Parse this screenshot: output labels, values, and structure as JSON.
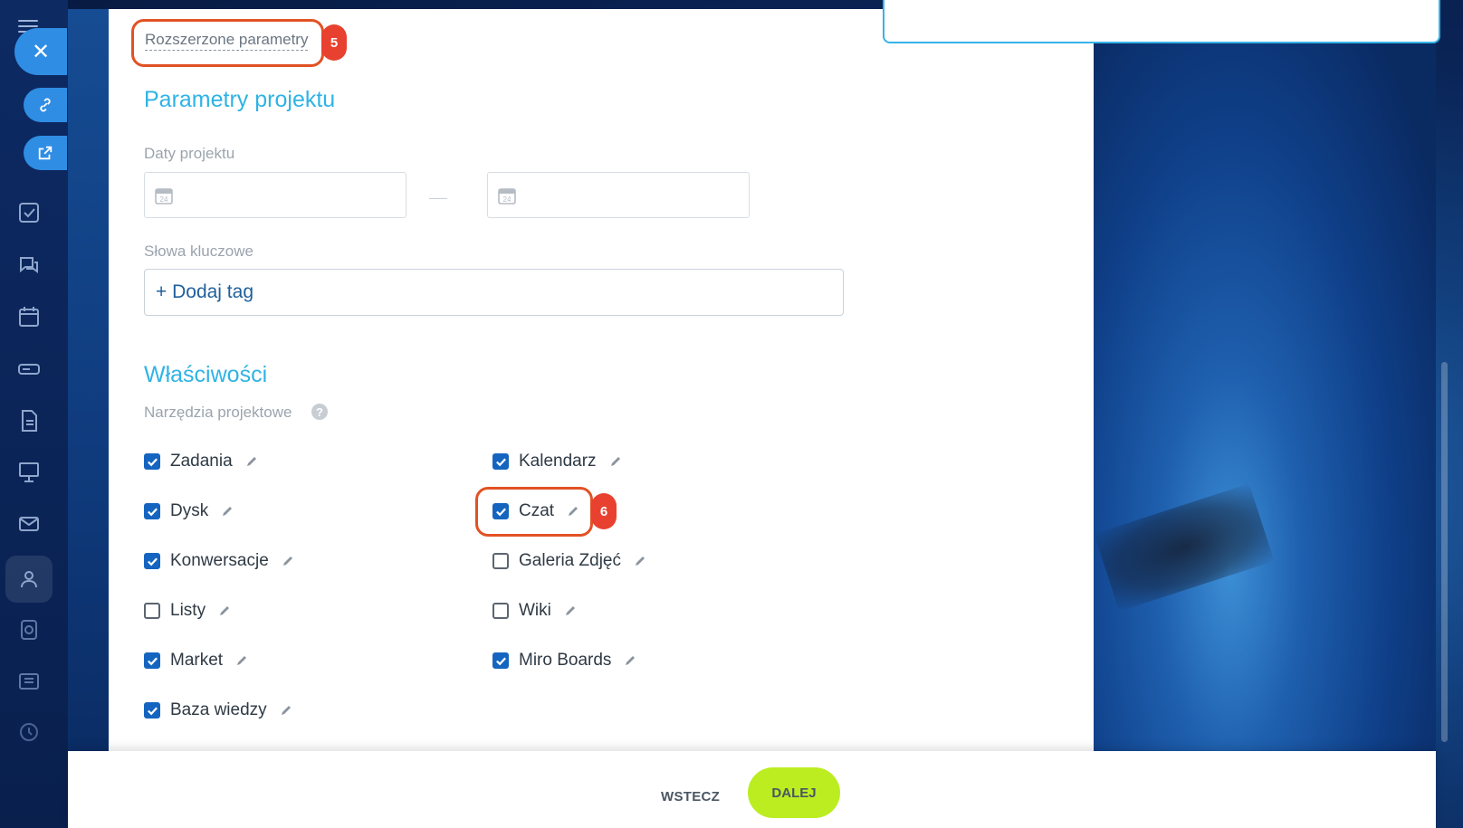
{
  "advanced_link": "Rozszerzone parametry",
  "callouts": {
    "advanced": "5",
    "chat": "6"
  },
  "project_params": {
    "title": "Parametry projektu",
    "dates_label": "Daty projektu",
    "keywords_label": "Słowa kluczowe",
    "add_tag": "+ Dodaj tag"
  },
  "properties": {
    "title": "Właściwości",
    "tools_label": "Narzędzia projektowe",
    "help": "?",
    "tools_left": [
      {
        "label": "Zadania",
        "checked": true
      },
      {
        "label": "Dysk",
        "checked": true
      },
      {
        "label": "Konwersacje",
        "checked": true
      },
      {
        "label": "Listy",
        "checked": false
      },
      {
        "label": "Market",
        "checked": true
      },
      {
        "label": "Baza wiedzy",
        "checked": true
      }
    ],
    "tools_right": [
      {
        "label": "Kalendarz",
        "checked": true
      },
      {
        "label": "Czat",
        "checked": true
      },
      {
        "label": "Galeria Zdjęć",
        "checked": false
      },
      {
        "label": "Wiki",
        "checked": false
      },
      {
        "label": "Miro Boards",
        "checked": true
      }
    ]
  },
  "footer": {
    "back": "WSTECZ",
    "next": "DALEJ"
  },
  "colors": {
    "accent": "#2fb3e4",
    "checkbox": "#1565c0",
    "next_button": "#bbed21",
    "callout": "#e25224"
  },
  "icons": [
    "menu-icon",
    "close-icon",
    "link-icon",
    "external-link-icon",
    "calendar-icon",
    "pencil-icon",
    "help-icon"
  ]
}
